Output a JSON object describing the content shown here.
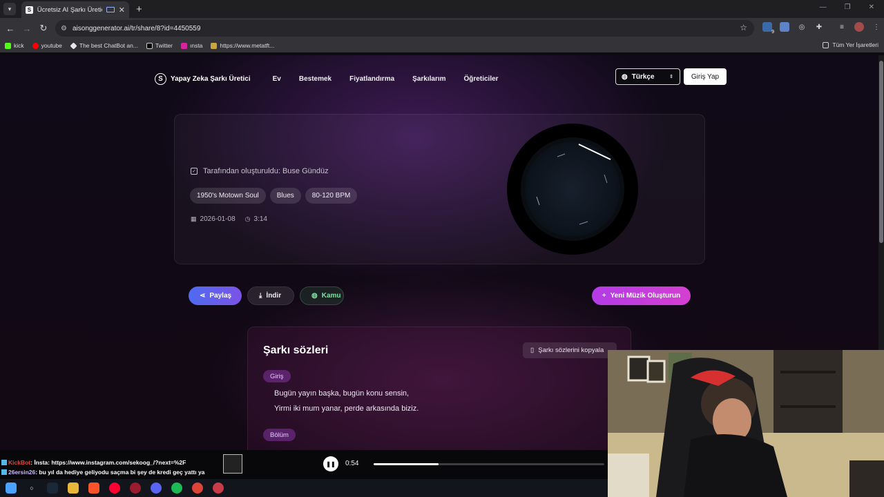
{
  "browser": {
    "tab_title": "Ücretsiz AI Şarkı Üretici - AI",
    "url": "aisonggenerator.ai/tr/share/8?id=4450559",
    "bookmarks": [
      "kick",
      "youtube",
      "The best ChatBot an...",
      "Twitter",
      "ınsta",
      "https://www.metatft..."
    ],
    "bookmarks_all": "Tüm Yer İşaretleri",
    "extension_badge": "9"
  },
  "site": {
    "logo_letter": "S",
    "logo_text": "Yapay Zeka Şarkı Üretici",
    "nav": [
      "Ev",
      "Bestemek",
      "Fiyatlandırma",
      "Şarkılarım",
      "Öğreticiler"
    ],
    "language": "Türkçe",
    "login": "Giriş Yap"
  },
  "song": {
    "creator": "Tarafından oluşturuldu: Buse Gündüz",
    "tags": [
      "1950's Motown Soul",
      "Blues",
      "80-120 BPM"
    ],
    "date": "2026-01-08",
    "duration": "3:14"
  },
  "actions": {
    "share": "Paylaş",
    "download": "İndir",
    "public": "Kamu",
    "new_music": "Yeni Müzik Oluşturun"
  },
  "lyrics": {
    "title": "Şarkı sözleri",
    "copy": "Şarkı sözlerini kopyala",
    "sections": [
      {
        "label": "Giriş",
        "lines": [
          "Bugün yayın başka, bugün konu sensin,",
          "Yirmi iki mum yanar, perde arkasında biziz."
        ]
      },
      {
        "label": "Bölüm",
        "lines": []
      }
    ]
  },
  "player": {
    "time": "0:54",
    "progress": 0.28
  },
  "chat": {
    "line1_user": "KickBot",
    "line1_text": ": İnsta: https://www.instagram.com/sekoog_/?next=%2F",
    "line2_user": "26ersin26",
    "line2_text": ": bu yıl da hediye geliyodu saçma bi şey de kredi geç yattı ya"
  },
  "colors": {
    "accent_share": "#5b64ee",
    "accent_new": "#c33ddc",
    "public_green": "#7fe0a0"
  }
}
